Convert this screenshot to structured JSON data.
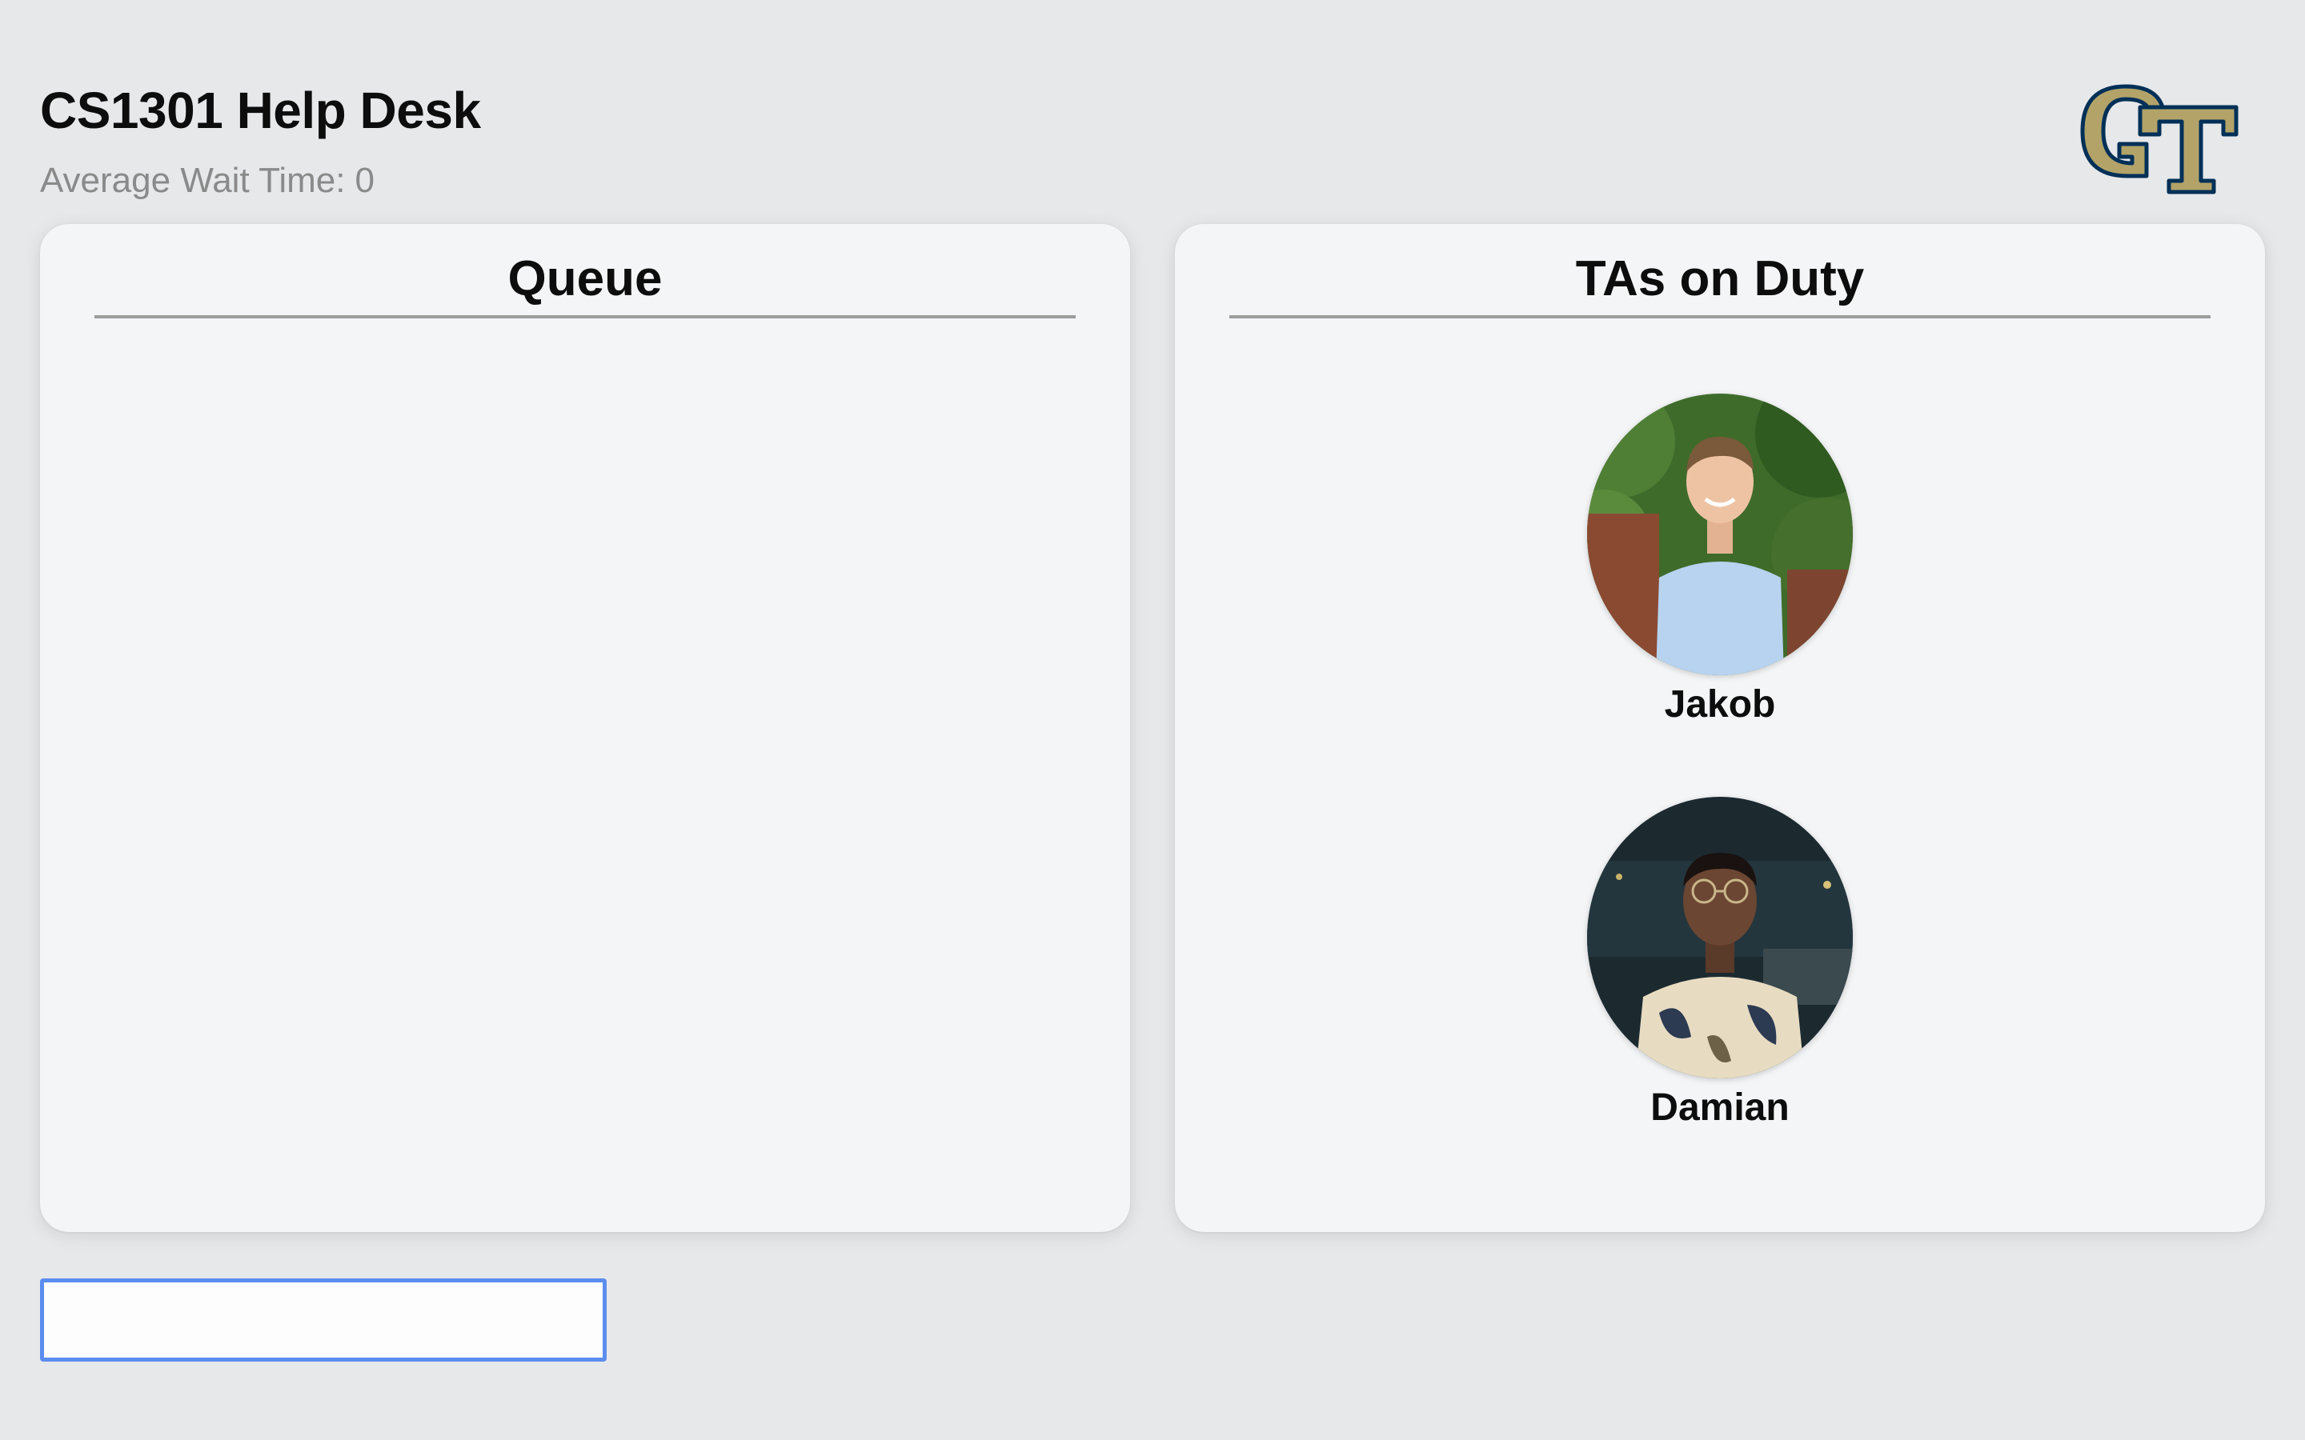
{
  "header": {
    "title": "CS1301 Help Desk",
    "wait_time_label": "Average Wait Time:",
    "wait_time_value": "0",
    "logo": "georgia-tech-gt-logo"
  },
  "queue": {
    "heading": "Queue",
    "entries": []
  },
  "tas": {
    "heading": "TAs on Duty",
    "list": [
      {
        "name": "Jakob",
        "photo": "ta-photo"
      },
      {
        "name": "Damian",
        "photo": "ta-photo"
      }
    ]
  },
  "input": {
    "value": "",
    "placeholder": ""
  },
  "colors": {
    "background": "#e7e8ea",
    "panel": "#f4f5f7",
    "input_border": "#5b8def",
    "logo_gold": "#b3a369",
    "logo_navy": "#003057",
    "subtitle": "#8a8a8a"
  }
}
